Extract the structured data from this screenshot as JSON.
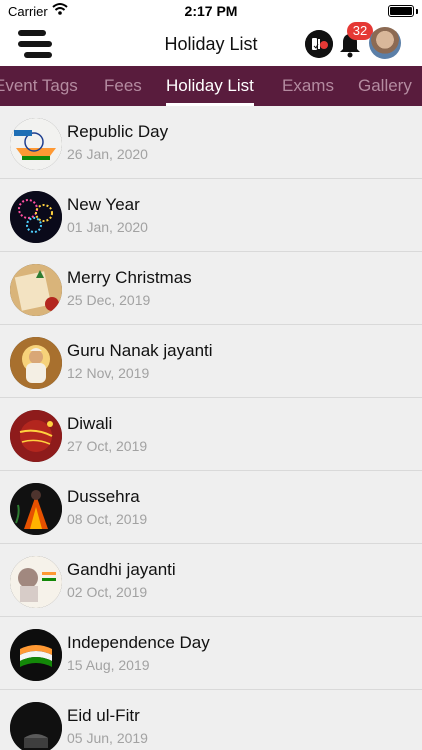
{
  "status_bar": {
    "carrier": "Carrier",
    "time": "2:17 PM"
  },
  "header": {
    "title": "Holiday List",
    "notification_count": "32"
  },
  "tabs": [
    {
      "label": "Event Tags"
    },
    {
      "label": "Fees"
    },
    {
      "label": "Holiday List"
    },
    {
      "label": "Exams"
    },
    {
      "label": "Gallery"
    }
  ],
  "active_tab": "Holiday List",
  "holidays": [
    {
      "name": "Republic Day",
      "date": "26 Jan, 2020",
      "thumb": "republic-day"
    },
    {
      "name": "New Year",
      "date": "01 Jan, 2020",
      "thumb": "fireworks"
    },
    {
      "name": "Merry Christmas",
      "date": "25 Dec, 2019",
      "thumb": "christmas"
    },
    {
      "name": "Guru Nanak jayanti",
      "date": "12 Nov, 2019",
      "thumb": "guru-nanak"
    },
    {
      "name": "Diwali",
      "date": "27 Oct, 2019",
      "thumb": "diwali"
    },
    {
      "name": "Dussehra",
      "date": "08 Oct, 2019",
      "thumb": "dussehra"
    },
    {
      "name": "Gandhi jayanti",
      "date": "02 Oct, 2019",
      "thumb": "gandhi"
    },
    {
      "name": "Independence Day",
      "date": "15 Aug, 2019",
      "thumb": "independence"
    },
    {
      "name": "Eid ul-Fitr",
      "date": "05 Jun, 2019",
      "thumb": "eid"
    }
  ],
  "colors": {
    "tab_bar": "#591c3d",
    "badge": "#e53935",
    "date_text": "#a2a2a2"
  }
}
